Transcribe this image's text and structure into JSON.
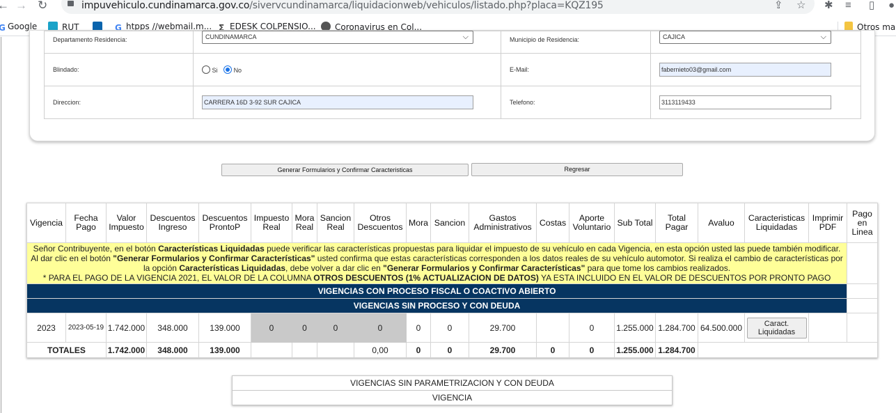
{
  "browser": {
    "url_host": "impuvehiculo.cundinamarca.gov.co",
    "url_path": "/sivervcundinamarca/liquidacionweb/vehiculos/listado.php?placa=KQZ195",
    "bookmarks": [
      "Google",
      "RUT",
      "htpps //webmail.m...",
      "EDESK COLPENSIO...",
      "Coronavirus en Col..."
    ],
    "other_bookmarks": "Otros ma"
  },
  "form": {
    "dept_label": "Departamento Residencia:",
    "dept_value": "CUNDINAMARCA",
    "municipio_label": "Municipio de Residencia:",
    "municipio_value": "CAJICA",
    "blindado_label": "Blindado:",
    "blindado_si": "Si",
    "blindado_no": "No",
    "email_label": "E-Mail:",
    "email_value": "fabernieto03@gmail.com",
    "direccion_label": "Direccion:",
    "direccion_value": "CARRERA 16D 3-92 SUR CAJICA",
    "telefono_label": "Telefono:",
    "telefono_value": "3113119433"
  },
  "actions": {
    "generate_label": "Generar Formularios y Confirmar Caracteristicas",
    "back_label": "Regresar"
  },
  "table": {
    "headers": [
      "Vigencia",
      "Fecha Pago",
      "Valor Impuesto",
      "Descuentos Ingreso",
      "Descuentos ProntoP",
      "Impuesto Real",
      "Mora Real",
      "Sancion Real",
      "Otros Descuentos",
      "Mora",
      "Sancion",
      "Gastos Administrativos",
      "Costas",
      "Aporte Voluntario",
      "Sub Total",
      "Total Pagar",
      "Avaluo",
      "Caracteristicas Liquidadas",
      "Imprimir PDF",
      "Pago en Linea"
    ],
    "info": {
      "p1": "Señor Contribuyente, en el botón ",
      "b1": "Características Liquidadas",
      "p2": " puede verificar las características propuestas para liquidar el impuesto de su vehículo en cada Vigencia, en esta opción usted las puede también modificar. Al dar clic en el botón ",
      "b2": "\"Generar Formularios y Confirmar Características\"",
      "p3": " usted confirma que estas características corresponden a los datos reales de su vehículo automotor. Si realiza el cambio de características por la opción ",
      "b3": "Características Liquidadas",
      "p4": ", debe volver a dar clic en ",
      "b4": "\"Generar Formularios y Confirmar Características\"",
      "p5": " para que tome los cambios realizados.",
      "n1": "* PARA EL PAGO DE LA VIGENCIA 2021, EL VALOR DE LA COLUMNA ",
      "nb": "OTROS DESCUENTOS (1% ACTUALIZACION DE DATOS)",
      "n2": " YA ESTA INCLUIDO EN EL VALOR DE DESCUENTOS POR PRONTO PAGO"
    },
    "band1": "VIGENCIAS CON PROCESO FISCAL O COACTIVO ABIERTO",
    "band2": "VIGENCIAS SIN PROCESO Y CON DEUDA",
    "row": {
      "vigencia": "2023",
      "fecha": "2023-05-19",
      "valor_impuesto": "1.742.000",
      "desc_ingreso": "348.000",
      "desc_prontop": "139.000",
      "impuesto_real": "0",
      "mora_real": "0",
      "sancion_real": "0",
      "otros_desc": "0",
      "mora": "0",
      "sancion": "0",
      "gastos": "29.700",
      "costas": "",
      "aporte": "0",
      "sub_total": "1.255.000",
      "total_pagar": "1.284.700",
      "avaluo": "64.500.000",
      "caract_button": "Caract. Liquidadas"
    },
    "totals": {
      "label": "TOTALES",
      "valor_impuesto": "1.742.000",
      "desc_ingreso": "348.000",
      "desc_prontop": "139.000",
      "otros_desc": "0,00",
      "mora": "0",
      "sancion": "0",
      "gastos": "29.700",
      "costas": "0",
      "aporte": "0",
      "sub_total": "1.255.000",
      "total_pagar": "1.284.700"
    }
  },
  "sub_table": {
    "title": "VIGENCIAS SIN PARAMETRIZACION Y CON DEUDA",
    "header": "VIGENCIA"
  }
}
